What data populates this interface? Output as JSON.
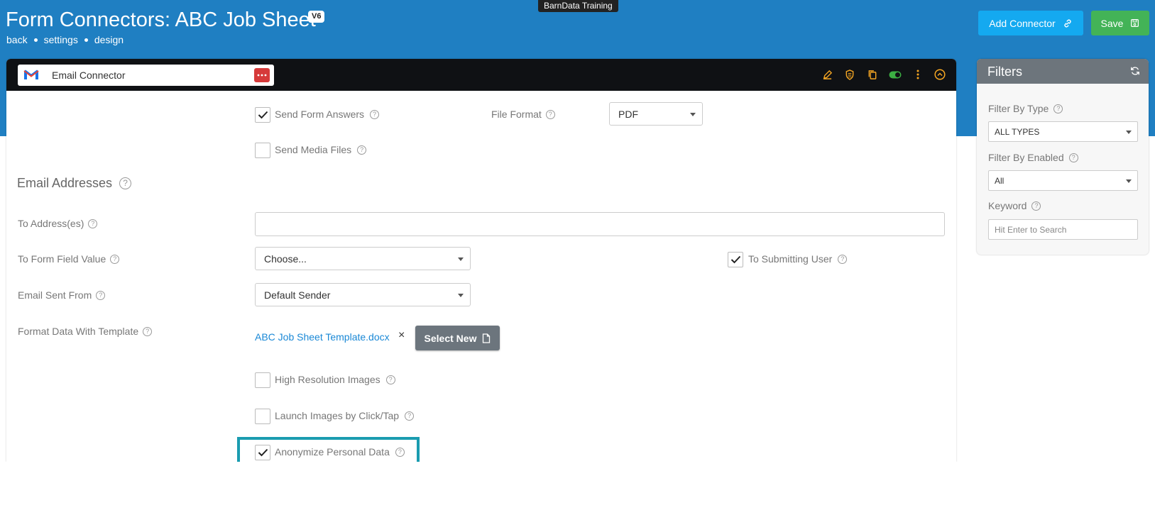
{
  "app": {
    "tooltip": "BarnData Training"
  },
  "header": {
    "title": "Form Connectors: ABC Job Sheet",
    "version_badge": "V6",
    "breadcrumb": [
      "back",
      "settings",
      "design"
    ],
    "add_connector_label": "Add Connector",
    "save_label": "Save"
  },
  "connector": {
    "name": "Email Connector",
    "icons": [
      "gmail-icon",
      "more-dots-icon",
      "edit-icon",
      "shield-icon",
      "copy-icon",
      "toggle-icon",
      "kebab-menu-icon",
      "collapse-icon"
    ],
    "send_form_answers": {
      "label": "Send Form Answers",
      "checked": true
    },
    "file_format": {
      "label": "File Format",
      "value": "PDF"
    },
    "send_media_files": {
      "label": "Send Media Files",
      "checked": false
    },
    "email_section_title": "Email Addresses",
    "to_addresses": {
      "label": "To Address(es)",
      "value": ""
    },
    "to_form_field": {
      "label": "To Form Field Value",
      "value": "Choose..."
    },
    "to_submitting_user": {
      "label": "To Submitting User",
      "checked": true
    },
    "email_sent_from": {
      "label": "Email Sent From",
      "value": "Default Sender"
    },
    "format_template": {
      "label": "Format Data With Template",
      "file": "ABC Job Sheet Template.docx",
      "remove": "×",
      "select_new_label": "Select New"
    },
    "high_res_images": {
      "label": "High Resolution Images",
      "checked": false
    },
    "launch_images": {
      "label": "Launch Images by Click/Tap",
      "checked": false
    },
    "anonymize": {
      "label": "Anonymize Personal Data",
      "checked": true
    }
  },
  "filters": {
    "title": "Filters",
    "by_type": {
      "label": "Filter By Type",
      "value": "ALL TYPES"
    },
    "by_enabled": {
      "label": "Filter By Enabled",
      "value": "All"
    },
    "keyword": {
      "label": "Keyword",
      "placeholder": "Hit Enter to Search"
    }
  },
  "colors": {
    "header_blue": "#1f7fc2",
    "add_button": "#14a9f0",
    "save_button": "#43b357",
    "link": "#1a88d6",
    "highlight": "#1a9cb0",
    "icon_orange": "#f5a623",
    "toggle_green": "#3cb043"
  }
}
